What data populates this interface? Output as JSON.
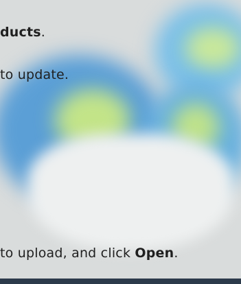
{
  "lines": {
    "line1": {
      "bold": "ducts",
      "rest": "."
    },
    "line2": {
      "text": "to update."
    },
    "line3": {
      "text": "to upload, and click ",
      "bold": "Open",
      "rest": "."
    }
  },
  "colors": {
    "background": "#d9dcdc",
    "globe_blue": "#5a9fd8",
    "globe_green": "#b8e07a",
    "bottom_bar": "#2c3a4b"
  }
}
